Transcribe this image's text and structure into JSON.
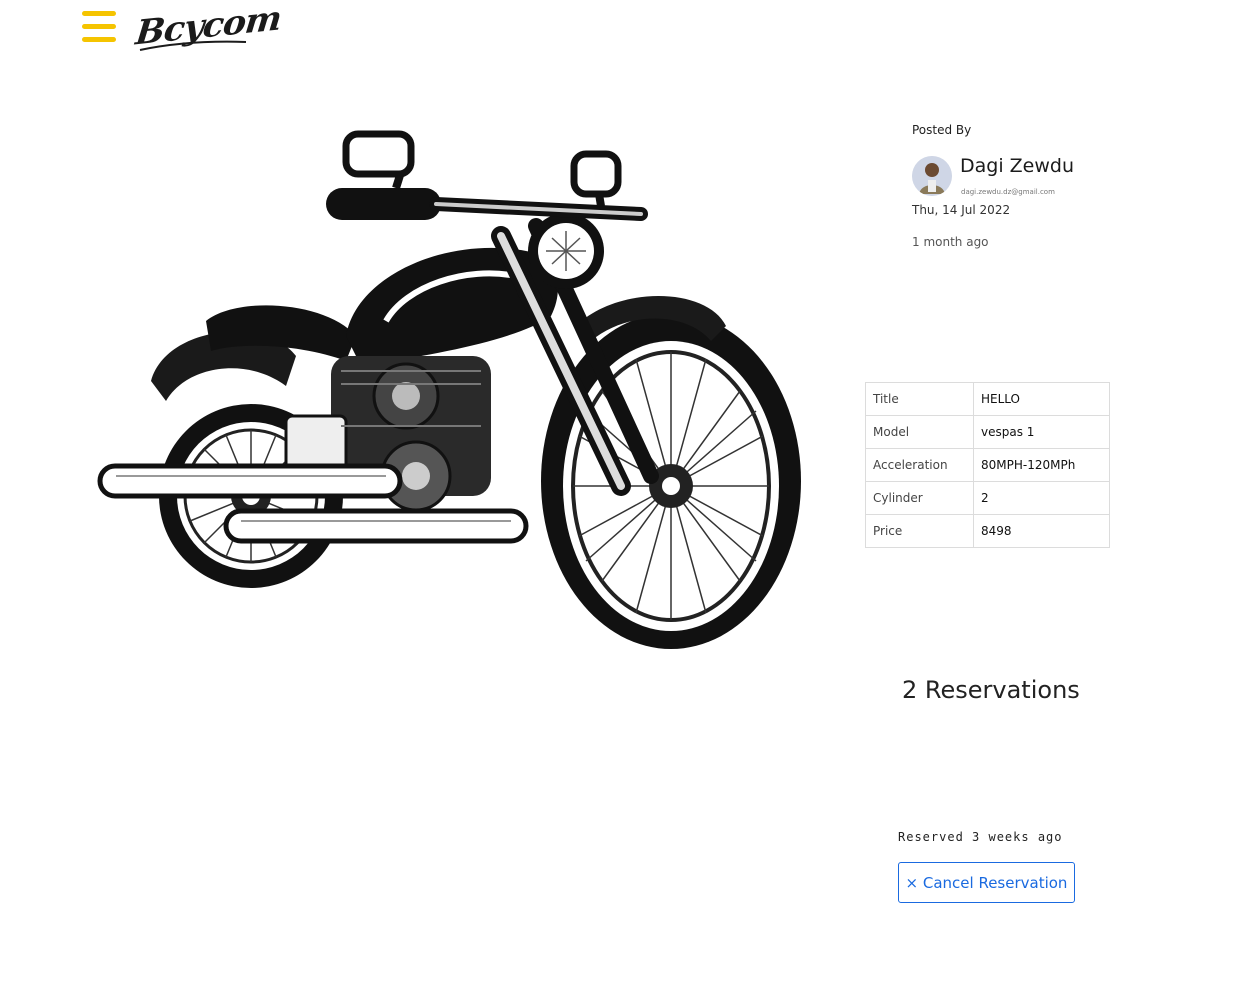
{
  "header": {
    "logo_text": "Bcycom",
    "menu_icon": "hamburger-icon",
    "accent_color": "#f5c400"
  },
  "hero": {
    "image_icon": "motorcycle-illustration"
  },
  "author": {
    "posted_by_label": "Posted By",
    "name": "Dagi Zewdu",
    "email": "dagi.zewdu.dz@gmail.com",
    "date": "Thu, 14 Jul 2022",
    "ago": "1 month ago"
  },
  "specs": [
    {
      "label": "Title",
      "value": "HELLO"
    },
    {
      "label": "Model",
      "value": "vespas 1"
    },
    {
      "label": "Acceleration",
      "value": "80MPH-120MPh"
    },
    {
      "label": "Cylinder",
      "value": "2"
    },
    {
      "label": "Price",
      "value": "8498"
    }
  ],
  "reservations": {
    "count_label": "2 Reservations",
    "reserved_ago": "Reserved 3 weeks ago",
    "cancel_label": "× Cancel Reservation",
    "button_color": "#1a6ae0"
  }
}
